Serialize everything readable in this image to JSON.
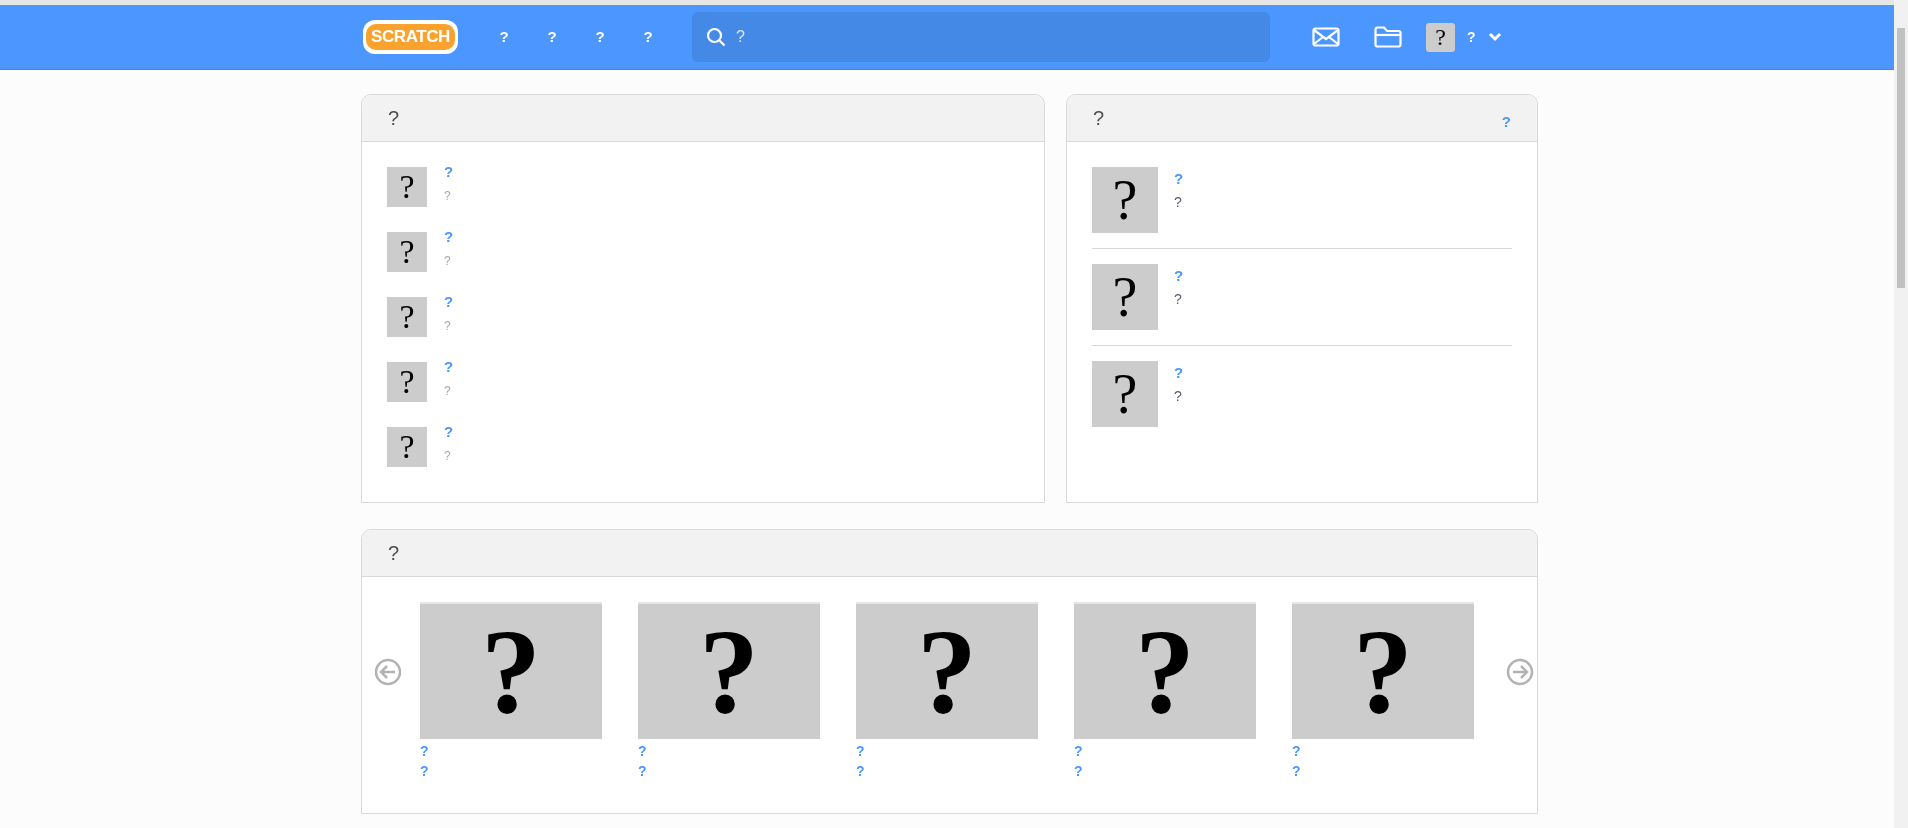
{
  "header": {
    "logo": "SCRATCH",
    "nav": [
      "?",
      "?",
      "?",
      "?"
    ],
    "search": {
      "placeholder": "?"
    },
    "user": {
      "avatar": "?",
      "name": "?"
    }
  },
  "activity": {
    "title": "?",
    "items": [
      {
        "thumb": "?",
        "title": "?",
        "detail": "?"
      },
      {
        "thumb": "?",
        "title": "?",
        "detail": "?"
      },
      {
        "thumb": "?",
        "title": "?",
        "detail": "?"
      },
      {
        "thumb": "?",
        "title": "?",
        "detail": "?"
      },
      {
        "thumb": "?",
        "title": "?",
        "detail": "?"
      }
    ]
  },
  "news": {
    "title": "?",
    "link": "?",
    "items": [
      {
        "thumb": "?",
        "title": "?",
        "detail": "?"
      },
      {
        "thumb": "?",
        "title": "?",
        "detail": "?"
      },
      {
        "thumb": "?",
        "title": "?",
        "detail": "?"
      }
    ]
  },
  "featured": {
    "title": "?",
    "items": [
      {
        "thumb": "?",
        "title": "?",
        "author": "?"
      },
      {
        "thumb": "?",
        "title": "?",
        "author": "?"
      },
      {
        "thumb": "?",
        "title": "?",
        "author": "?"
      },
      {
        "thumb": "?",
        "title": "?",
        "author": "?"
      },
      {
        "thumb": "?",
        "title": "?",
        "author": "?"
      }
    ]
  }
}
